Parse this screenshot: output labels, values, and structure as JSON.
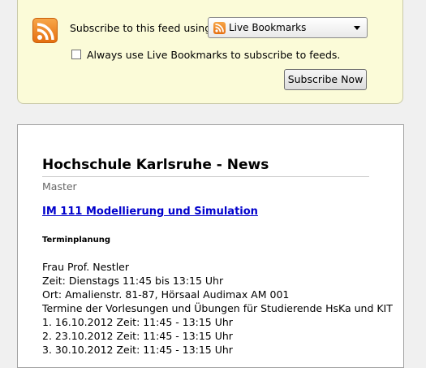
{
  "subscribe": {
    "prompt": "Subscribe to this feed using",
    "reader_selected": "Live Bookmarks",
    "always_label": "Always use Live Bookmarks to subscribe to feeds.",
    "always_checked": false,
    "button_label": "Subscribe Now"
  },
  "feed": {
    "title": "Hochschule Karlsruhe - News",
    "subtitle": "Master",
    "entry": {
      "link_text": "IM 111 Modellierung und Simulation",
      "heading": "Terminplanung",
      "lines": [
        "Frau Prof. Nestler",
        "Zeit: Dienstags 11:45 bis 13:15 Uhr",
        "Ort: Amalienstr. 81-87, Hörsaal Audimax AM 001",
        "Termine der Vorlesungen und Übungen für Studierende HsKa und KIT",
        "1. 16.10.2012 Zeit: 11:45 - 13:15 Uhr",
        "2. 23.10.2012 Zeit: 11:45 - 13:15 Uhr",
        "3. 30.10.2012 Zeit: 11:45 - 13:15 Uhr"
      ]
    }
  },
  "icons": [
    "feed-icon",
    "dropdown-arrow-icon"
  ],
  "colors": {
    "subscribe_bg": "#fbfbd8",
    "link": "#0000cc",
    "feed_orange": "#e56f10"
  }
}
